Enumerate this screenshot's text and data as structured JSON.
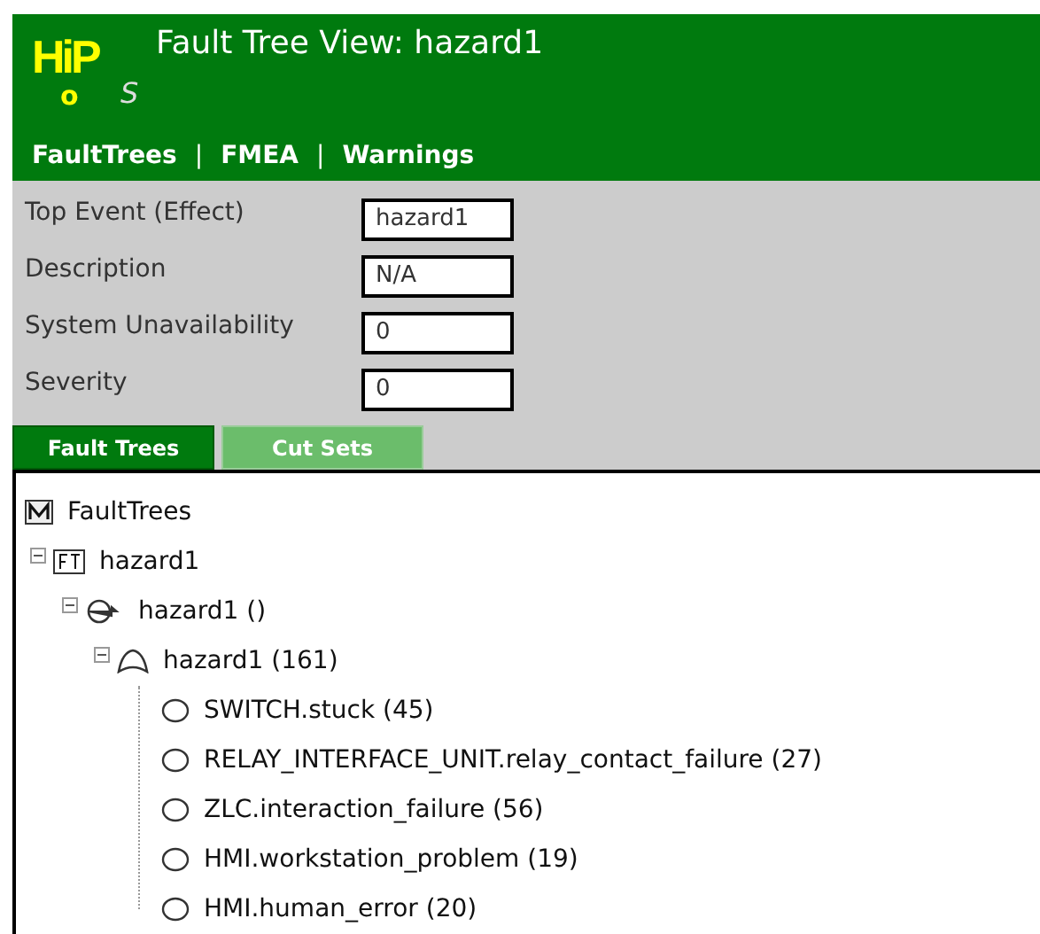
{
  "header": {
    "logo": {
      "main": "HiP",
      "lower": "o",
      "tail": "S"
    },
    "title": "Fault Tree View: hazard1"
  },
  "nav": [
    "FaultTrees",
    "FMEA",
    "Warnings"
  ],
  "nav_separator": "|",
  "fields": [
    {
      "label": "Top Event (Effect)",
      "value": "hazard1"
    },
    {
      "label": "Description",
      "value": "N/A"
    },
    {
      "label": "System Unavailability",
      "value": "0"
    },
    {
      "label": "Severity",
      "value": "0"
    }
  ],
  "tabs": [
    {
      "label": "Fault Trees",
      "selected": true
    },
    {
      "label": "Cut Sets",
      "selected": false
    }
  ],
  "tree": {
    "kind": "model",
    "label": "FaultTrees",
    "children": [
      {
        "kind": "faulttree",
        "label": "hazard1",
        "expanded": true,
        "children": [
          {
            "kind": "effect",
            "label": "hazard1 ()",
            "expanded": true,
            "children": [
              {
                "kind": "gate",
                "label": "hazard1 (161)",
                "expanded": true,
                "children": [
                  {
                    "kind": "event",
                    "label": "SWITCH.stuck (45)"
                  },
                  {
                    "kind": "event",
                    "label": "RELAY_INTERFACE_UNIT.relay_contact_failure (27)"
                  },
                  {
                    "kind": "event",
                    "label": "ZLC.interaction_failure (56)"
                  },
                  {
                    "kind": "event",
                    "label": "HMI.workstation_problem (19)"
                  },
                  {
                    "kind": "event",
                    "label": "HMI.human_error (20)"
                  }
                ]
              }
            ]
          }
        ]
      }
    ]
  }
}
